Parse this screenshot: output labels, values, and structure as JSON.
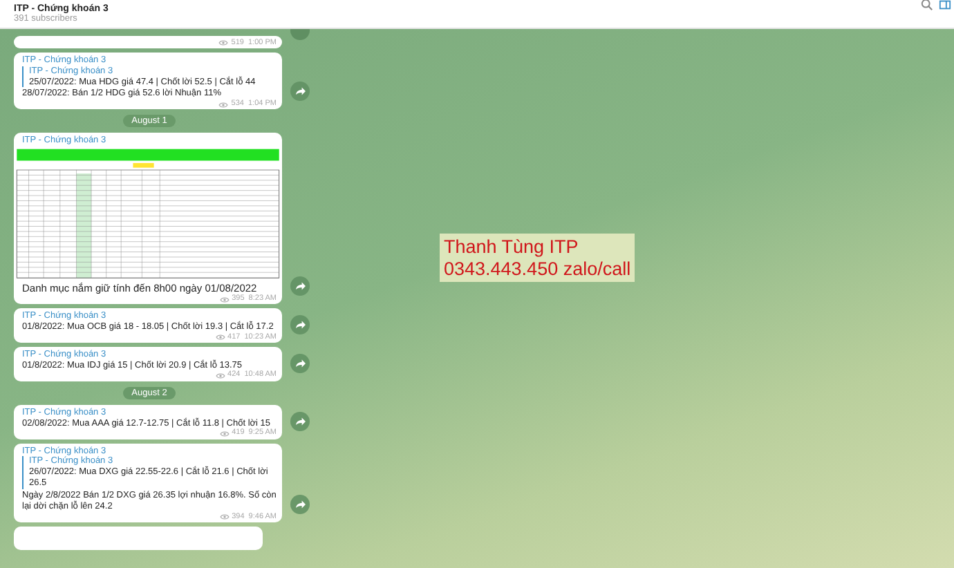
{
  "header": {
    "title": "ITP - Chứng khoán 3",
    "subtitle": "391 subscribers"
  },
  "feed": [
    {
      "kind": "partial",
      "views": "519",
      "time": "1:00 PM"
    },
    {
      "kind": "message",
      "author": "ITP - Chứng khoán 3",
      "quote": {
        "author": "ITP - Chứng khoán 3",
        "text": "25/07/2022: Mua HDG giá 47.4 | Chốt lời 52.5 | Cắt lỗ 44"
      },
      "text": "28/07/2022: Bán 1/2 HDG giá 52.6 lời Nhuận 11%",
      "views": "534",
      "time": "1:04 PM"
    },
    {
      "kind": "date",
      "label": "August 1"
    },
    {
      "kind": "image",
      "author": "ITP - Chứng khoán 3",
      "text": "Danh mục nắm giữ tính đến 8h00 ngày 01/08/2022",
      "views": "395",
      "time": "8:23 AM"
    },
    {
      "kind": "message",
      "author": "ITP - Chứng khoán 3",
      "text": "01/8/2022: Mua OCB giá 18 - 18.05 | Chốt lời 19.3 | Cắt lỗ 17.2",
      "views": "417",
      "time": "10:23 AM"
    },
    {
      "kind": "message",
      "author": "ITP - Chứng khoán 3",
      "text": "01/8/2022: Mua IDJ giá 15 | Chốt lời 20.9 | Cắt lỗ 13.75",
      "views": "424",
      "time": "10:48 AM"
    },
    {
      "kind": "date",
      "label": "August 2"
    },
    {
      "kind": "message",
      "author": "ITP - Chứng khoán 3",
      "text": "02/08/2022: Mua AAA giá 12.7-12.75 | Cắt lỗ  11.8  | Chốt lời 15",
      "views": "419",
      "time": "9:25 AM"
    },
    {
      "kind": "message",
      "author": "ITP - Chứng khoán 3",
      "quote": {
        "author": "ITP - Chứng khoán 3",
        "text": "26/07/2022: Mua DXG giá  22.55-22.6 | Cắt lỗ 21.6 | Chốt lời 26.5"
      },
      "text": "Ngày 2/8/2022 Bán 1/2 DXG giá 26.35 lợi nhuận 16.8%. Số còn lại dời chặn lỗ lên 24.2",
      "views": "394",
      "time": "9:46 AM"
    },
    {
      "kind": "stub"
    }
  ],
  "overlay": {
    "line1": "Thanh Tùng ITP",
    "line2": "0343.443.450 zalo/call"
  }
}
